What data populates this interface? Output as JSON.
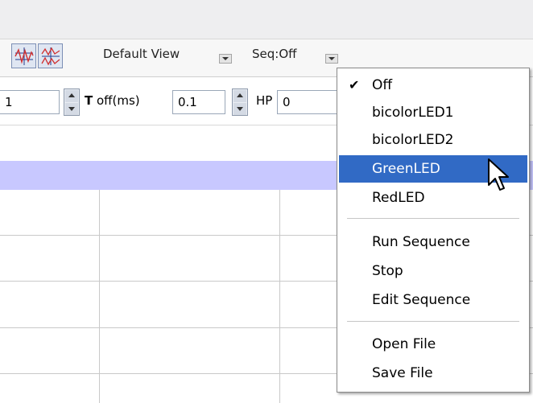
{
  "toolbar": {
    "view_label": "Default View",
    "seq_label": "Seq:Off",
    "view_icon_1": "trace-overlay-icon",
    "view_icon_2": "trace-split-icon"
  },
  "params": {
    "first_value": "1",
    "toff_label": "T off(ms)",
    "toff_value": "0.1",
    "hp_label": "HP",
    "hp_value": "0"
  },
  "menu": {
    "checked_item": "Off",
    "highlight_color": "#316ac5",
    "items": [
      {
        "label": "Off",
        "checked": true
      },
      {
        "label": "bicolorLED1"
      },
      {
        "label": "bicolorLED2"
      },
      {
        "label": "GreenLED",
        "highlighted": true
      },
      {
        "label": "RedLED"
      },
      {
        "label": "Run Sequence"
      },
      {
        "label": "Stop"
      },
      {
        "label": "Edit Sequence"
      },
      {
        "label": "Open File"
      },
      {
        "label": "Save File"
      }
    ]
  },
  "colors": {
    "header_band": "#c8c8ff",
    "menu_highlight": "#316ac5"
  }
}
